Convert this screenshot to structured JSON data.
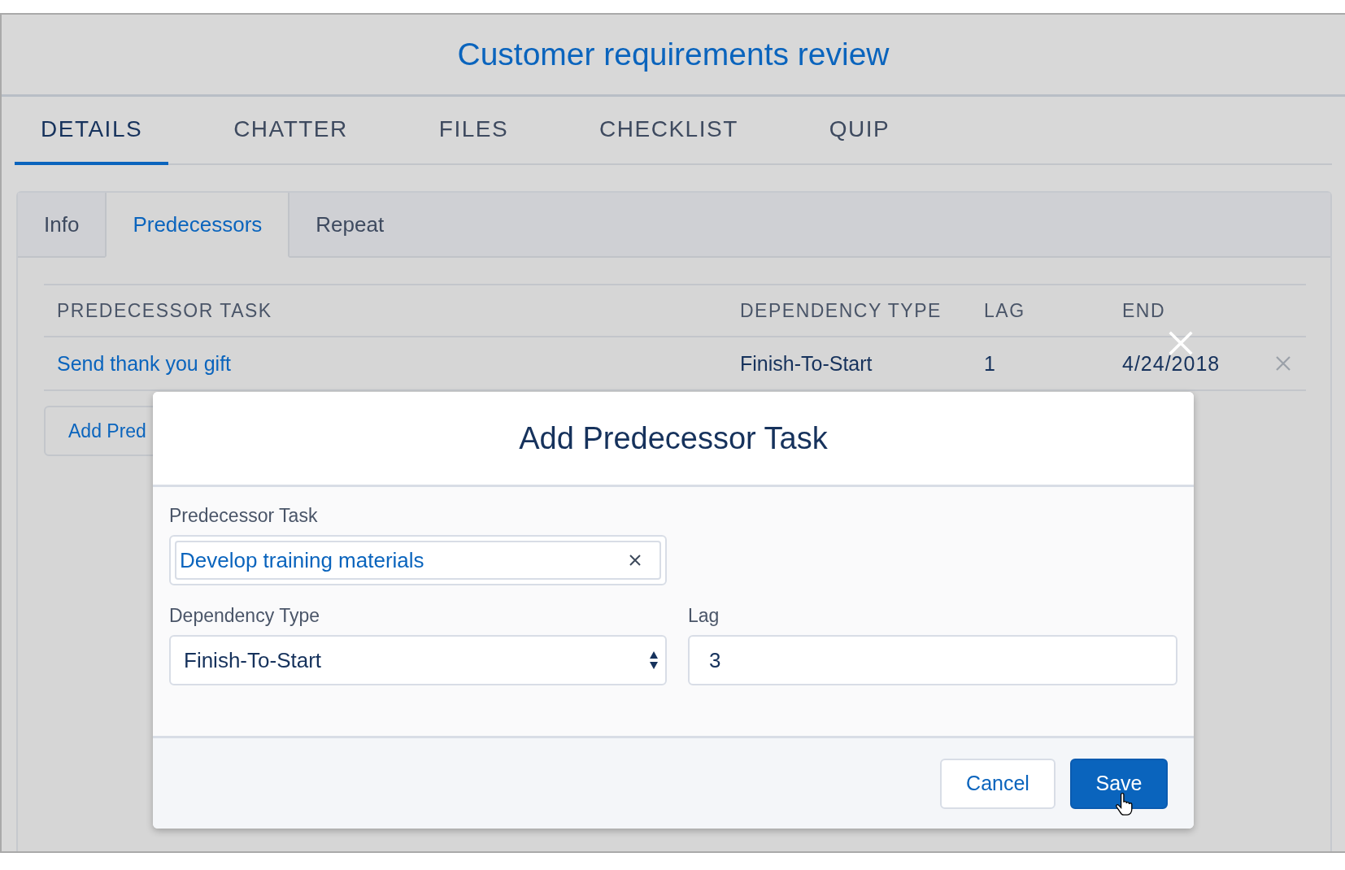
{
  "record_title": "Customer requirements review",
  "tabs": [
    {
      "label": "DETAILS",
      "selected": true
    },
    {
      "label": "CHATTER",
      "selected": false
    },
    {
      "label": "FILES",
      "selected": false
    },
    {
      "label": "CHECKLIST",
      "selected": false
    },
    {
      "label": "QUIP",
      "selected": false
    }
  ],
  "subtabs": [
    {
      "label": "Info",
      "selected": false
    },
    {
      "label": "Predecessors",
      "selected": true
    },
    {
      "label": "Repeat",
      "selected": false
    }
  ],
  "table": {
    "columns": [
      "PREDECESSOR TASK",
      "DEPENDENCY TYPE",
      "LAG",
      "END"
    ],
    "rows": [
      {
        "task": "Send thank you gift",
        "dependency_type": "Finish-To-Start",
        "lag": "1",
        "end": "4/24/2018"
      }
    ]
  },
  "add_button": "Add Pred",
  "modal": {
    "title": "Add Predecessor Task",
    "predecessor_task": {
      "label": "Predecessor Task",
      "value": "Develop training materials"
    },
    "dependency_type": {
      "label": "Dependency Type",
      "value": "Finish-To-Start"
    },
    "lag": {
      "label": "Lag",
      "value": "3"
    },
    "buttons": [
      {
        "label": "Cancel",
        "kind": "neutral"
      },
      {
        "label": "Save",
        "kind": "brand"
      }
    ]
  }
}
